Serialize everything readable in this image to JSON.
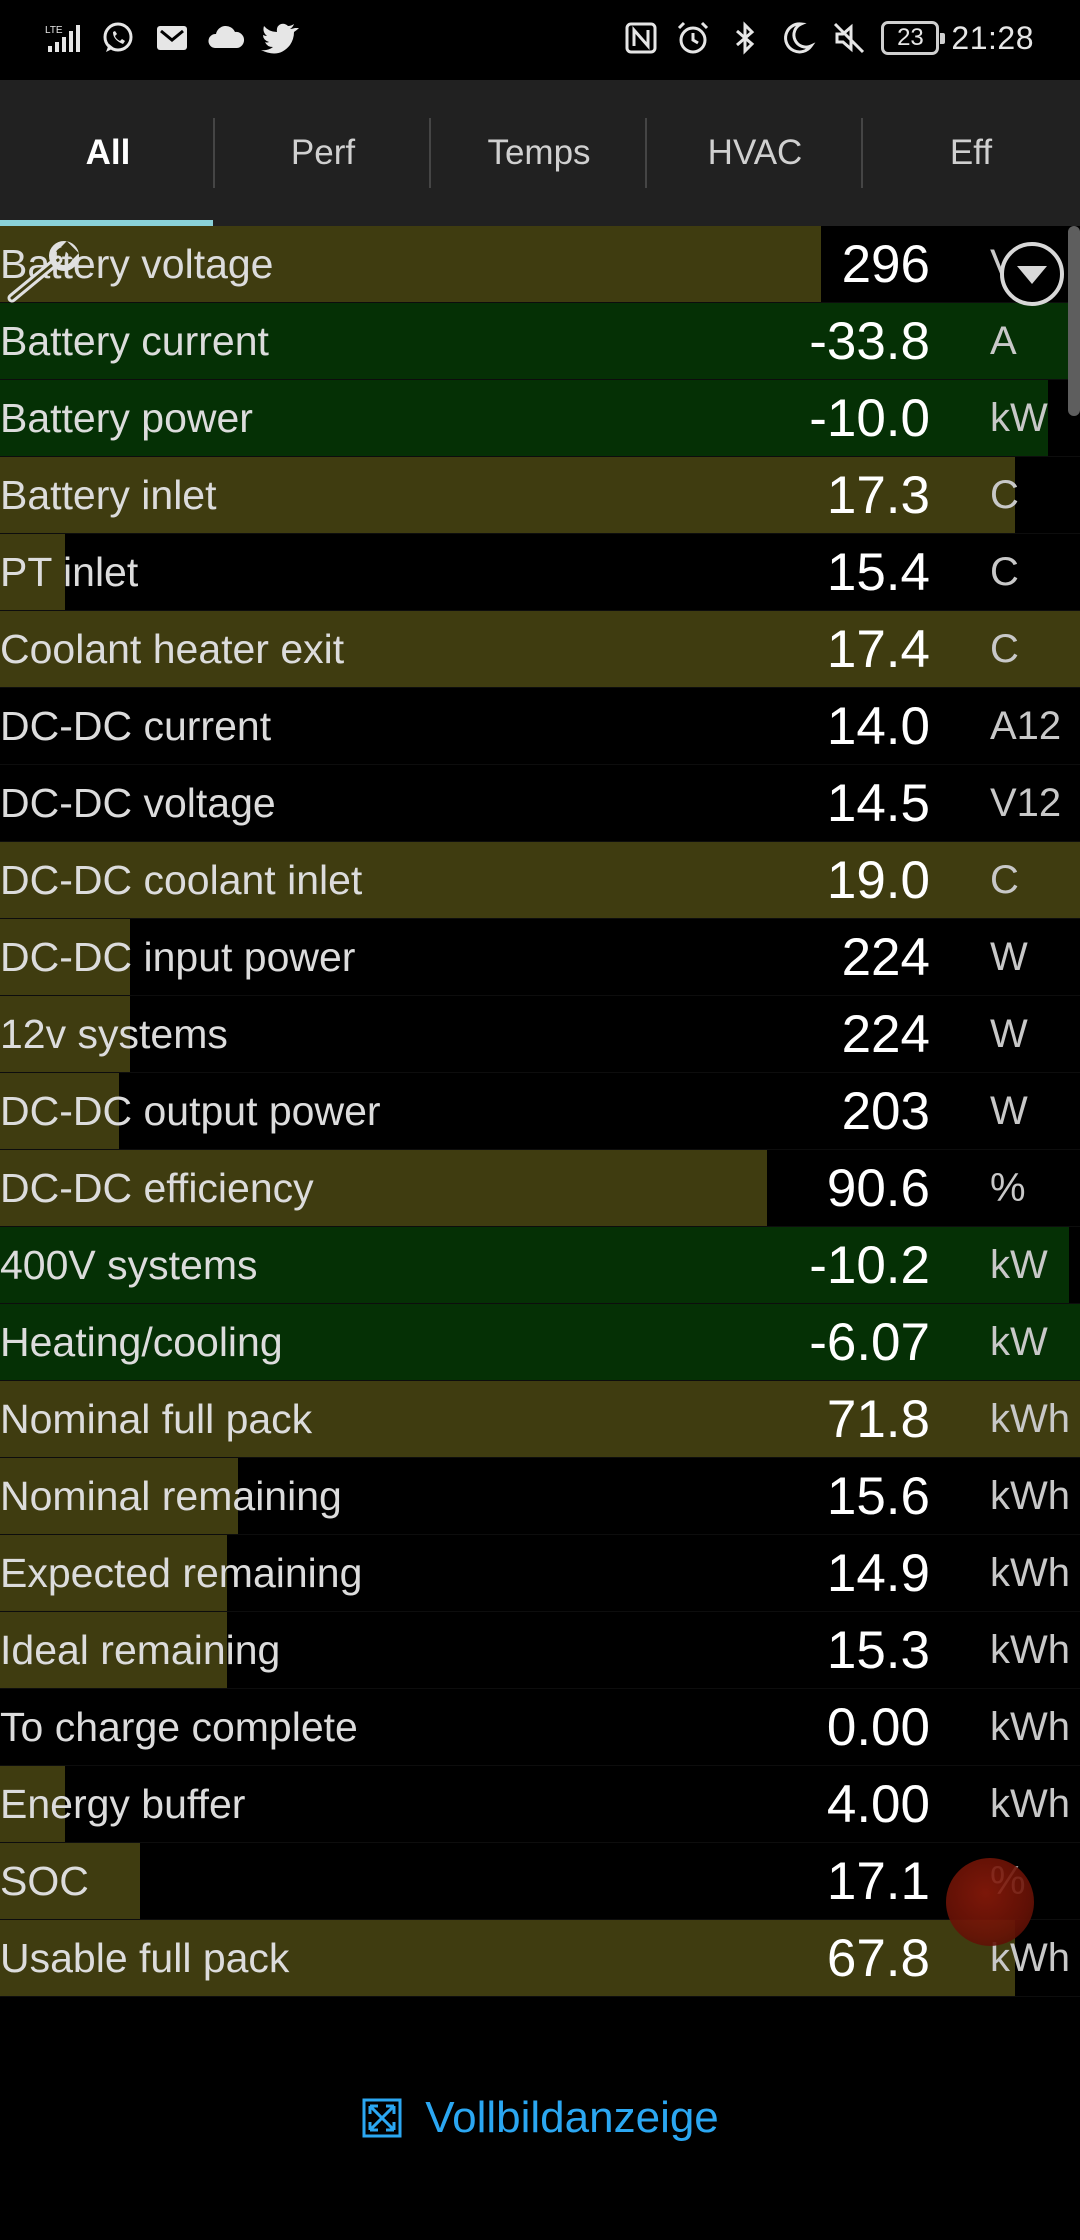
{
  "status_bar": {
    "network": "LTE",
    "battery_level": "23",
    "time": "21:28",
    "left_icons": [
      "lte-signal-icon",
      "whatsapp-icon",
      "mail-icon",
      "cloud-icon",
      "twitter-icon"
    ],
    "right_icons": [
      "nfc-icon",
      "alarm-icon",
      "bluetooth-icon",
      "moon-icon",
      "mute-icon"
    ]
  },
  "tabs": [
    {
      "label": "All",
      "active": true
    },
    {
      "label": "Perf",
      "active": false
    },
    {
      "label": "Temps",
      "active": false
    },
    {
      "label": "HVAC",
      "active": false
    },
    {
      "label": "Eff",
      "active": false
    }
  ],
  "rows": [
    {
      "label": "Battery voltage",
      "value": "296",
      "unit": "V",
      "bar_color": "olive",
      "fill": 0.76
    },
    {
      "label": "Battery current",
      "value": "-33.8",
      "unit": "A",
      "bar_color": "green",
      "fill": 0.99
    },
    {
      "label": "Battery power",
      "value": "-10.0",
      "unit": "kW",
      "bar_color": "green",
      "fill": 0.97
    },
    {
      "label": "Battery inlet",
      "value": "17.3",
      "unit": "C",
      "bar_color": "olive",
      "fill": 0.94
    },
    {
      "label": "PT inlet",
      "value": "15.4",
      "unit": "C",
      "bar_color": "olive",
      "fill": 0.06
    },
    {
      "label": "Coolant heater exit",
      "value": "17.4",
      "unit": "C",
      "bar_color": "olive",
      "fill": 1.0
    },
    {
      "label": "DC-DC current",
      "value": "14.0",
      "unit": "A12",
      "bar_color": "none",
      "fill": 0
    },
    {
      "label": "DC-DC voltage",
      "value": "14.5",
      "unit": "V12",
      "bar_color": "none",
      "fill": 0
    },
    {
      "label": "DC-DC coolant inlet",
      "value": "19.0",
      "unit": "C",
      "bar_color": "olive",
      "fill": 1.0
    },
    {
      "label": "DC-DC input power",
      "value": "224",
      "unit": "W",
      "bar_color": "olive",
      "fill": 0.12
    },
    {
      "label": "12v systems",
      "value": "224",
      "unit": "W",
      "bar_color": "olive",
      "fill": 0.12
    },
    {
      "label": "DC-DC output power",
      "value": "203",
      "unit": "W",
      "bar_color": "olive",
      "fill": 0.11
    },
    {
      "label": "DC-DC efficiency",
      "value": "90.6",
      "unit": "%",
      "bar_color": "olive",
      "fill": 0.71
    },
    {
      "label": "400V systems",
      "value": "-10.2",
      "unit": "kW",
      "bar_color": "green",
      "fill": 0.99
    },
    {
      "label": "Heating/cooling",
      "value": "-6.07",
      "unit": "kW",
      "bar_color": "green",
      "fill": 1.0
    },
    {
      "label": "Nominal full pack",
      "value": "71.8",
      "unit": "kWh",
      "bar_color": "olive",
      "fill": 1.0
    },
    {
      "label": "Nominal remaining",
      "value": "15.6",
      "unit": "kWh",
      "bar_color": "olive",
      "fill": 0.22
    },
    {
      "label": "Expected remaining",
      "value": "14.9",
      "unit": "kWh",
      "bar_color": "olive",
      "fill": 0.21
    },
    {
      "label": "Ideal remaining",
      "value": "15.3",
      "unit": "kWh",
      "bar_color": "olive",
      "fill": 0.21
    },
    {
      "label": "To charge complete",
      "value": "0.00",
      "unit": "kWh",
      "bar_color": "none",
      "fill": 0
    },
    {
      "label": "Energy buffer",
      "value": "4.00",
      "unit": "kWh",
      "bar_color": "olive",
      "fill": 0.06
    },
    {
      "label": "SOC",
      "value": "17.1",
      "unit": "%",
      "bar_color": "olive",
      "fill": 0.13
    },
    {
      "label": "Usable full pack",
      "value": "67.8",
      "unit": "kWh",
      "bar_color": "olive",
      "fill": 0.94
    }
  ],
  "footer": {
    "fullscreen_label": "Vollbildanzeige"
  },
  "colors": {
    "bar_olive": "#3f3c10",
    "bar_green": "#053005",
    "tab_indicator": "#8ad2d8",
    "link": "#2ba7f2"
  }
}
